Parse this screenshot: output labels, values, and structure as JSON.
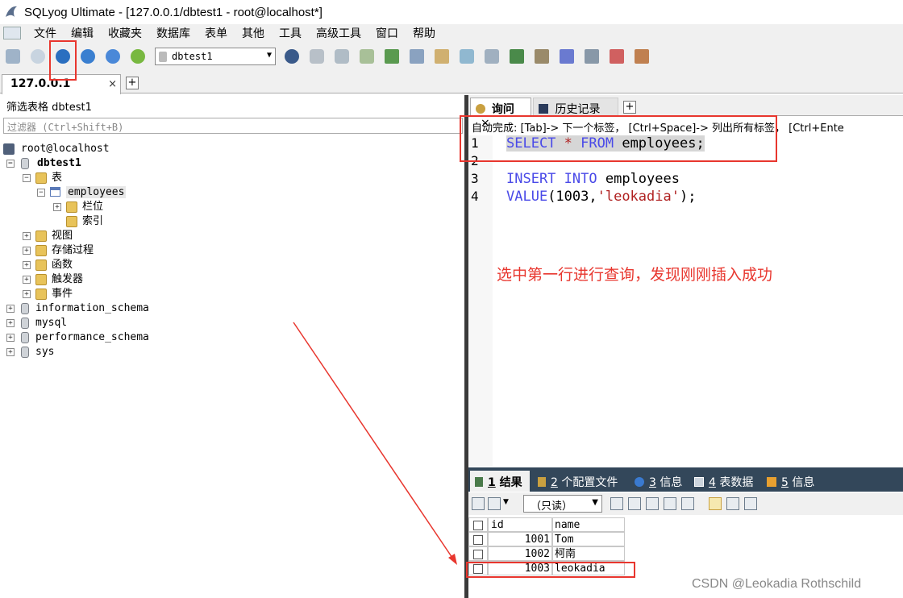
{
  "window": {
    "title": "SQLyog Ultimate - [127.0.0.1/dbtest1 - root@localhost*]"
  },
  "menu": [
    "文件",
    "编辑",
    "收藏夹",
    "数据库",
    "表单",
    "其他",
    "工具",
    "高级工具",
    "窗口",
    "帮助"
  ],
  "toolbar": {
    "database_select": "dbtest1"
  },
  "connection_tab": {
    "label": "127.0.0.1",
    "close": "×"
  },
  "object_browser": {
    "filter_label": "筛选表格 dbtest1",
    "filter_placeholder": "过滤器 (Ctrl+Shift+B)",
    "tree": {
      "root": "root@localhost",
      "db": "dbtest1",
      "tables": "表",
      "employees": "employees",
      "columns": "栏位",
      "indexes": "索引",
      "views": "视图",
      "procs": "存储过程",
      "funcs": "函数",
      "triggers": "触发器",
      "events": "事件",
      "info_schema": "information_schema",
      "mysql": "mysql",
      "perf_schema": "performance_schema",
      "sys": "sys"
    }
  },
  "query_tabs": {
    "query": "询问",
    "history": "历史记录"
  },
  "autocomplete_hint": "自动完成: [Tab]-> 下一个标签， [Ctrl+Space]-> 列出所有标签， [Ctrl+Ente",
  "editor": {
    "line_numbers": [
      "1",
      "2",
      "3",
      "4"
    ],
    "l1_kw1": "SELECT",
    "l1_star": " * ",
    "l1_kw2": "FROM",
    "l1_rest": " employees;",
    "l3_kw1": "INSERT",
    "l3_kw2": "INTO",
    "l3_rest": " employees",
    "l4_kw": "VALUE",
    "l4_a": "(1003,",
    "l4_str": "'leokadia'",
    "l4_b": ");"
  },
  "annotation": "选中第一行进行查询，发现刚刚插入成功",
  "result_tabs": [
    {
      "num": "1",
      "label": " 结果"
    },
    {
      "num": "2",
      "label": " 个配置文件"
    },
    {
      "num": "3",
      "label": " 信息"
    },
    {
      "num": "4",
      "label": " 表数据"
    },
    {
      "num": "5",
      "label": " 信息"
    }
  ],
  "result_mode": "（只读）",
  "result_grid": {
    "columns": [
      "id",
      "name"
    ],
    "rows": [
      [
        "1001",
        "Tom"
      ],
      [
        "1002",
        "柯南"
      ],
      [
        "1003",
        "leokadia"
      ]
    ]
  },
  "watermark": "CSDN @Leokadia Rothschild"
}
